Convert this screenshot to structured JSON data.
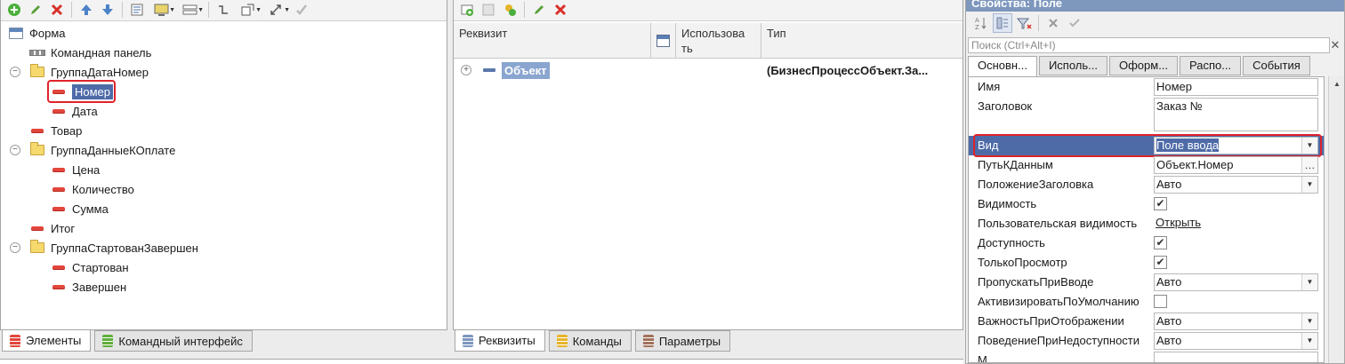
{
  "left": {
    "tree": [
      {
        "label": "Форма",
        "icon": "form-icon",
        "level": 0
      },
      {
        "label": "Командная панель",
        "icon": "command-bar-icon",
        "level": 1
      },
      {
        "label": "ГруппаДатаНомер",
        "icon": "folder-icon",
        "level": 1,
        "expander": "⊖"
      },
      {
        "label": "Номер",
        "icon": "field-icon",
        "level": 2,
        "selected": true
      },
      {
        "label": "Дата",
        "icon": "field-icon",
        "level": 2
      },
      {
        "label": "Товар",
        "icon": "field-icon",
        "level": 1
      },
      {
        "label": "ГруппаДанныеКОплате",
        "icon": "folder-icon",
        "level": 1,
        "expander": "⊖"
      },
      {
        "label": "Цена",
        "icon": "field-icon",
        "level": 2
      },
      {
        "label": "Количество",
        "icon": "field-icon",
        "level": 2
      },
      {
        "label": "Сумма",
        "icon": "field-icon",
        "level": 2
      },
      {
        "label": "Итог",
        "icon": "field-icon",
        "level": 1
      },
      {
        "label": "ГруппаСтартованЗавершен",
        "icon": "folder-icon",
        "level": 1,
        "expander": "⊖"
      },
      {
        "label": "Стартован",
        "icon": "field-icon",
        "level": 2
      },
      {
        "label": "Завершен",
        "icon": "field-icon",
        "level": 2
      }
    ],
    "tabs": [
      {
        "label": "Элементы",
        "active": true,
        "color": "#e2463c"
      },
      {
        "label": "Командный интерфейс",
        "active": false,
        "color": "#5fae3c"
      }
    ]
  },
  "middle": {
    "columns": {
      "rekvizit": "Реквизит",
      "use_line1": "Использова",
      "use_line2": "ть",
      "type": "Тип"
    },
    "row": {
      "name": "Объект",
      "type": "(БизнесПроцессОбъект.За..."
    },
    "tabs": [
      {
        "label": "Реквизиты",
        "active": true,
        "color": "#7d97bd"
      },
      {
        "label": "Команды",
        "active": false,
        "color": "#e6b32a"
      },
      {
        "label": "Параметры",
        "active": false,
        "color": "#a0705a"
      }
    ]
  },
  "props": {
    "title": "Свойства: Поле",
    "search_placeholder": "Поиск (Ctrl+Alt+I)",
    "tabs": [
      "Основн...",
      "Исполь...",
      "Оформ...",
      "Распо...",
      "События"
    ],
    "rows": [
      {
        "label": "Имя",
        "value": "Номер",
        "kind": "text"
      },
      {
        "label": "Заголовок",
        "value": "Заказ №",
        "kind": "tall"
      },
      {
        "label": "Вид",
        "value": "Поле ввода",
        "kind": "select",
        "highlight": true
      },
      {
        "label": "ПутьКДанным",
        "value": "Объект.Номер",
        "kind": "ellipsis"
      },
      {
        "label": "ПоложениеЗаголовка",
        "value": "Авто",
        "kind": "select"
      },
      {
        "label": "Видимость",
        "value": "✔",
        "kind": "check"
      },
      {
        "label": "Пользовательская видимость",
        "value": "Открыть",
        "kind": "link"
      },
      {
        "label": "Доступность",
        "value": "✔",
        "kind": "check"
      },
      {
        "label": "ТолькоПросмотр",
        "value": "✔",
        "kind": "check"
      },
      {
        "label": "ПропускатьПриВводе",
        "value": "Авто",
        "kind": "select"
      },
      {
        "label": "АктивизироватьПоУмолчанию",
        "value": "",
        "kind": "check"
      },
      {
        "label": "ВажностьПриОтображении",
        "value": "Авто",
        "kind": "select"
      },
      {
        "label": "ПоведениеПриНедоступности",
        "value": "Авто",
        "kind": "select"
      },
      {
        "label": "М",
        "value": "",
        "kind": "text"
      }
    ]
  }
}
